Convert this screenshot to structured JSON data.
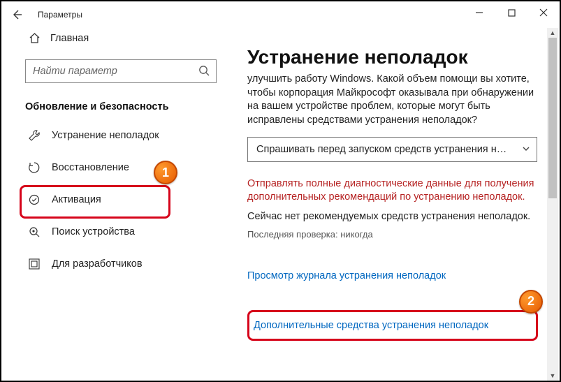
{
  "window": {
    "title": "Параметры"
  },
  "sidebar": {
    "home": "Главная",
    "search_placeholder": "Найти параметр",
    "section": "Обновление и безопасность",
    "items": [
      {
        "label": "Устранение неполадок",
        "icon": "wrench"
      },
      {
        "label": "Восстановление",
        "icon": "recovery"
      },
      {
        "label": "Активация",
        "icon": "activation"
      },
      {
        "label": "Поиск устройства",
        "icon": "find-device"
      },
      {
        "label": "Для разработчиков",
        "icon": "developer"
      }
    ]
  },
  "content": {
    "title": "Устранение неполадок",
    "desc": "улучшить работу Windows. Какой объем помощи вы хотите, чтобы корпорация Майкрософт оказывала при обнаружении на вашем устройстве проблем, которые могут быть исправлены средствами устранения неполадок?",
    "select": "Спрашивать перед запуском средств устранения непо…",
    "warning": "Отправлять полные диагностические данные для получения дополнительных рекомендаций по устранению неполадок.",
    "status": "Сейчас нет рекомендуемых средств устранения неполадок.",
    "last_check": "Последняя проверка: никогда",
    "link_history": "Просмотр журнала устранения неполадок",
    "link_more": "Дополнительные средства устранения неполадок"
  },
  "markers": {
    "one": "1",
    "two": "2"
  }
}
